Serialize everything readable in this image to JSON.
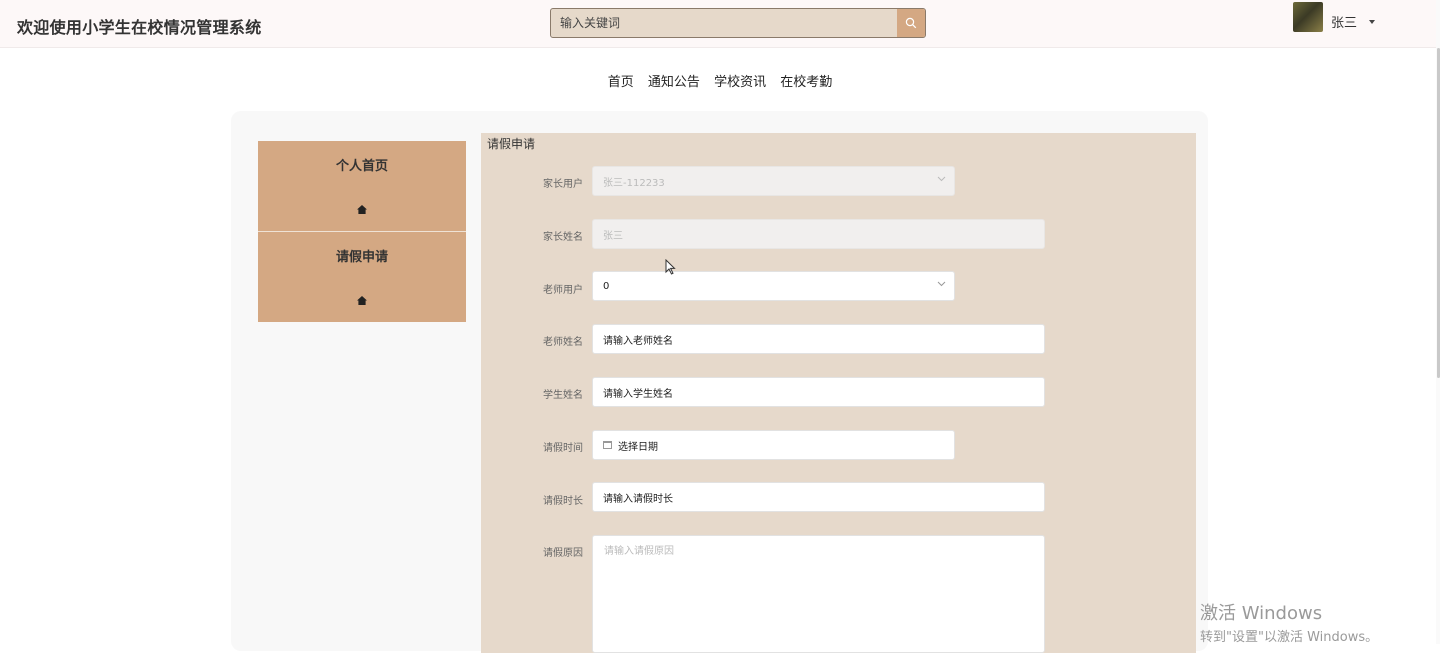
{
  "header": {
    "title": "欢迎使用小学生在校情况管理系统",
    "search_placeholder": "输入关键词",
    "username": "张三"
  },
  "nav": {
    "items": [
      "首页",
      "通知公告",
      "学校资讯",
      "在校考勤"
    ]
  },
  "sidebar": {
    "items": [
      {
        "label": "个人首页",
        "icon": "home-icon"
      },
      {
        "label": "请假申请",
        "icon": "home-icon"
      }
    ]
  },
  "form": {
    "title": "请假申请",
    "fields": [
      {
        "label": "家长用户",
        "value": "张三-112233",
        "type": "select-disabled"
      },
      {
        "label": "家长姓名",
        "value": "张三",
        "type": "input-disabled"
      },
      {
        "label": "老师用户",
        "value": "0",
        "type": "select"
      },
      {
        "label": "老师姓名",
        "value": "请输入老师姓名",
        "type": "input"
      },
      {
        "label": "学生姓名",
        "value": "请输入学生姓名",
        "type": "input"
      },
      {
        "label": "请假时间",
        "value": "选择日期",
        "type": "date"
      },
      {
        "label": "请假时长",
        "value": "请输入请假时长",
        "type": "input"
      },
      {
        "label": "请假原因",
        "placeholder": "请输入请假原因",
        "type": "textarea"
      }
    ]
  },
  "watermark": {
    "line1": "激活 Windows",
    "line2": "转到\"设置\"以激活 Windows。"
  },
  "colors": {
    "accent": "#d4a883",
    "panel": "#e6d9cb",
    "header_bg": "#fdf8f8"
  }
}
